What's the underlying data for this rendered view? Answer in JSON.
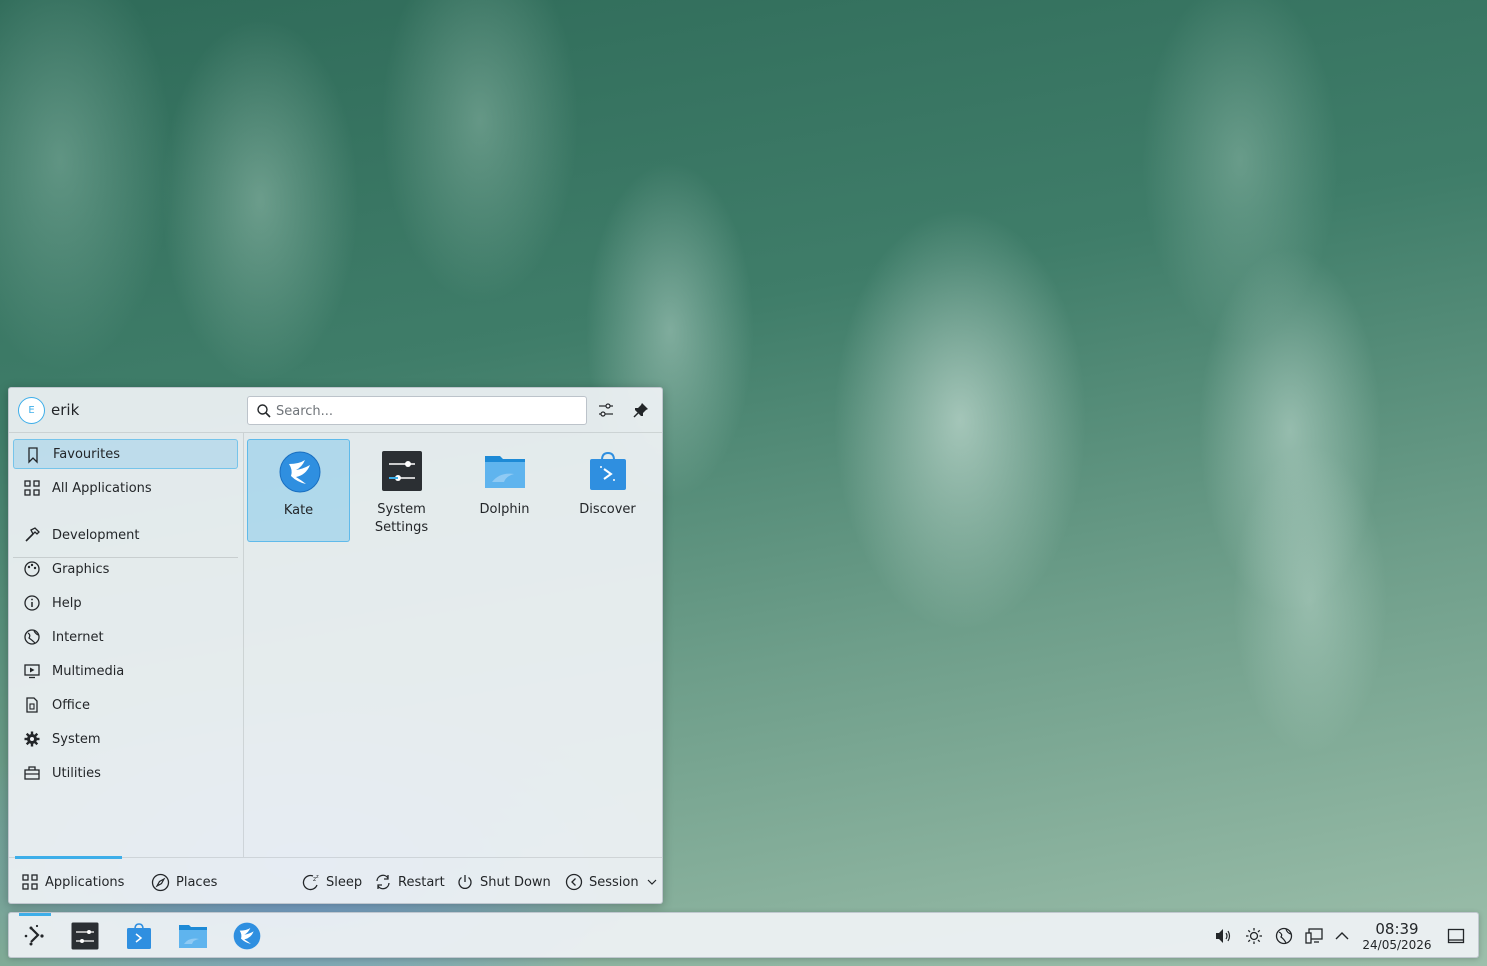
{
  "launcher": {
    "user": {
      "initial": "E",
      "name": "erik"
    },
    "search": {
      "placeholder": "Search..."
    },
    "sidebar": {
      "items": [
        {
          "label": "Favourites",
          "icon": "bookmark-icon",
          "active": true
        },
        {
          "label": "All Applications",
          "icon": "grid-icon"
        },
        {
          "label": "Development",
          "icon": "hammer-icon"
        },
        {
          "label": "Graphics",
          "icon": "palette-icon"
        },
        {
          "label": "Help",
          "icon": "info-icon"
        },
        {
          "label": "Internet",
          "icon": "globe-icon"
        },
        {
          "label": "Multimedia",
          "icon": "media-icon"
        },
        {
          "label": "Office",
          "icon": "document-icon"
        },
        {
          "label": "System",
          "icon": "gear-icon"
        },
        {
          "label": "Utilities",
          "icon": "toolbox-icon"
        }
      ]
    },
    "favourites": [
      {
        "label": "Kate",
        "icon": "kate-icon",
        "selected": true
      },
      {
        "label": "System Settings",
        "label_line1": "System",
        "label_line2": "Settings",
        "icon": "system-settings-icon"
      },
      {
        "label": "Dolphin",
        "icon": "dolphin-icon"
      },
      {
        "label": "Discover",
        "icon": "discover-icon"
      }
    ],
    "footer": {
      "tabs": [
        {
          "label": "Applications",
          "active": true
        },
        {
          "label": "Places"
        }
      ],
      "actions": [
        {
          "label": "Sleep"
        },
        {
          "label": "Restart"
        },
        {
          "label": "Shut Down"
        },
        {
          "label": "Session"
        }
      ]
    }
  },
  "taskbar": {
    "apps": [
      "application-launcher",
      "System Settings",
      "Discover",
      "Dolphin",
      "Kate"
    ],
    "clock": {
      "time": "08:39",
      "date": "24/05/2026"
    }
  },
  "colors": {
    "accent": "#3daee9",
    "panel": "#eff2f5",
    "text": "#232629"
  }
}
